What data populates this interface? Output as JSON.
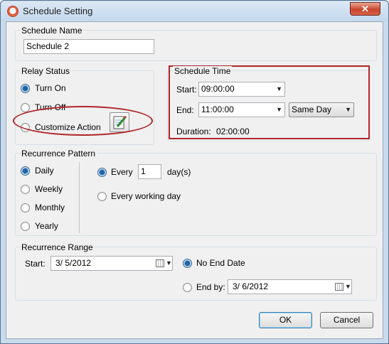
{
  "window": {
    "title": "Schedule Setting",
    "close_glyph": "✕",
    "app_icon": "alarm-clock-icon"
  },
  "schedule_name": {
    "group_label": "Schedule Name",
    "value": "Schedule 2"
  },
  "relay_status": {
    "group_label": "Relay Status",
    "options": [
      "Turn On",
      "Turn Off",
      "Customize Action"
    ],
    "selected": "Turn On",
    "action_icon": "notepad-pencil-icon"
  },
  "schedule_time": {
    "group_label": "Schedule Time",
    "start_label": "Start:",
    "start_value": "09:00:00",
    "end_label": "End:",
    "end_value": "11:00:00",
    "day_value": "Same Day",
    "duration_label": "Duration:",
    "duration_value": "02:00:00"
  },
  "recurrence_pattern": {
    "group_label": "Recurrence Pattern",
    "options": [
      "Daily",
      "Weekly",
      "Monthly",
      "Yearly"
    ],
    "selected": "Daily",
    "every_label": "Every",
    "every_value": "1",
    "every_unit": "day(s)",
    "every_working_day_label": "Every working day"
  },
  "recurrence_range": {
    "group_label": "Recurrence Range",
    "start_label": "Start:",
    "start_value": "3/  5/2012",
    "no_end_label": "No End Date",
    "end_by_label": "End by:",
    "end_by_value": "3/  6/2012",
    "selected": "No End Date"
  },
  "buttons": {
    "ok": "OK",
    "cancel": "Cancel"
  },
  "colors": {
    "annotation_red": "#b0262a",
    "title_bar": "#c9dcee",
    "close_button": "#c9452c"
  }
}
